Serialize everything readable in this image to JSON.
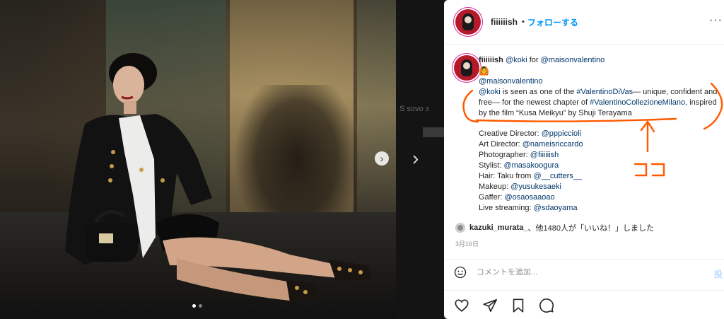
{
  "post": {
    "username": "fiiiiiish",
    "follow_dot": "•",
    "follow_label": "フォローする",
    "more_label": "···"
  },
  "caption": {
    "username": "fiiiiiish",
    "mention_koki": "@koki",
    "for_text": " for ",
    "mention_maison": "@maisonvalentino",
    "emoji": "🙆",
    "brand_line": "@maisonvalentino",
    "p1_mention": "@koki",
    "p1_text1": " is seen as one of the ",
    "p1_hashtag1": "#ValentinoDiVas",
    "p1_text2": "— unique, confident and free— for the newest chapter of ",
    "p1_hashtag2": "#ValentinoCollezioneMilano",
    "p1_text3": ", inspired by the film “Kusa Meikyu” by Shuji Terayama",
    "credits": [
      {
        "role": "Creative Director: ",
        "handle": "@pppiccioli"
      },
      {
        "role": "Art Director: ",
        "handle": "@nameisriccardo"
      },
      {
        "role": "Photographer: ",
        "handle": "@fiiiiiish"
      },
      {
        "role": "Stylist: ",
        "handle": "@masakoogura"
      },
      {
        "role": "Hair: Taku from ",
        "handle": "@__cutters__"
      },
      {
        "role": "Makeup: ",
        "handle": "@yusukesaeki"
      },
      {
        "role": "Gaffer: ",
        "handle": "@osaosaaoao"
      },
      {
        "role": "Live streaming: ",
        "handle": "@sdaoyama"
      }
    ]
  },
  "likes": {
    "user": "kazuki_murata_",
    "text": "、他1480人が「いいね！」しました"
  },
  "date": "3月16日",
  "comment": {
    "placeholder": "コメントを追加...",
    "post_label": "投"
  },
  "annotation": {
    "label": "ココ",
    "color": "#ff5a00"
  },
  "gap": {
    "next_label": "›",
    "faint_text": "Ѕ ѕоvо з"
  },
  "icons": [
    "heart-icon",
    "comment-icon",
    "bookmark-icon",
    "message-icon",
    "share-icon",
    "emoji-icon",
    "carousel-next-icon",
    "more-icon"
  ],
  "colors": {
    "link": "#00376b",
    "follow": "#0095f6",
    "annotation": "#ff5a00"
  }
}
